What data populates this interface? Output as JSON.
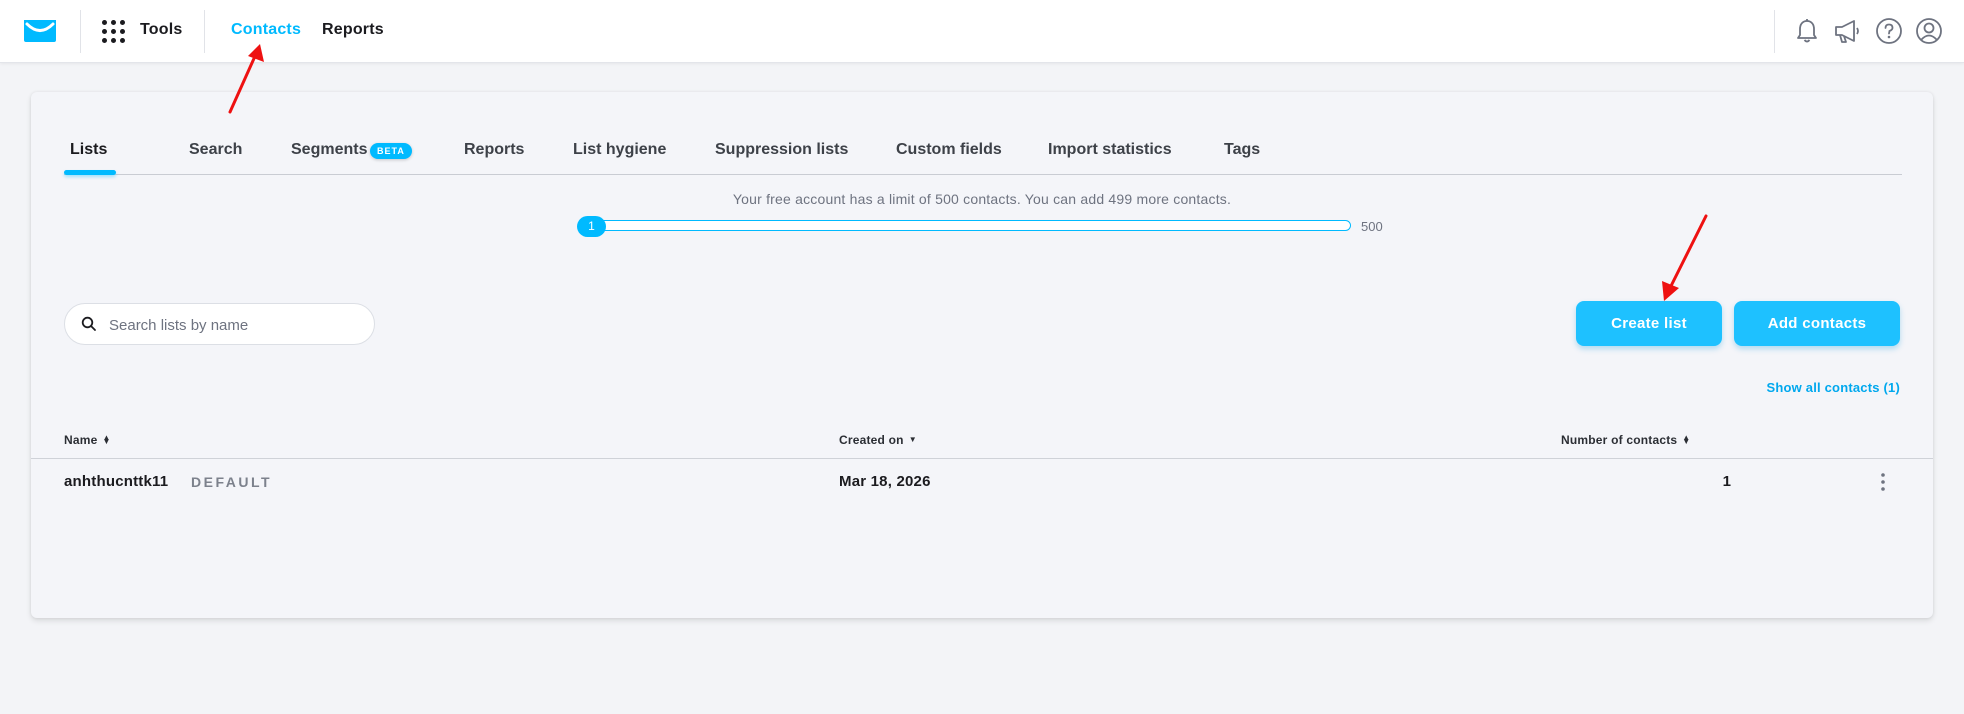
{
  "topbar": {
    "tools_label": "Tools",
    "nav": [
      {
        "label": "Contacts",
        "active": true
      },
      {
        "label": "Reports",
        "active": false
      }
    ],
    "icons": [
      "bell-icon",
      "megaphone-icon",
      "help-icon",
      "user-icon"
    ]
  },
  "tabs": [
    {
      "label": "Lists",
      "active": true
    },
    {
      "label": "Search",
      "active": false
    },
    {
      "label": "Segments",
      "active": false,
      "badge": "BETA"
    },
    {
      "label": "Reports",
      "active": false
    },
    {
      "label": "List hygiene",
      "active": false
    },
    {
      "label": "Suppression lists",
      "active": false
    },
    {
      "label": "Custom fields",
      "active": false
    },
    {
      "label": "Import statistics",
      "active": false
    },
    {
      "label": "Tags",
      "active": false
    }
  ],
  "limit": {
    "text": "Your free account has a limit of 500 contacts. You can add 499 more contacts.",
    "current": "1",
    "max": "500",
    "fill_fraction": 0.002
  },
  "search": {
    "placeholder": "Search lists by name",
    "value": ""
  },
  "buttons": {
    "create_list": "Create list",
    "add_contacts": "Add contacts"
  },
  "show_all": "Show all contacts (1)",
  "table": {
    "columns": [
      {
        "label": "Name",
        "sort": "both"
      },
      {
        "label": "Created on",
        "sort": "down"
      },
      {
        "label": "Number of contacts",
        "sort": "both"
      }
    ],
    "rows": [
      {
        "name": "anhthucnttk11",
        "badge": "DEFAULT",
        "created_on": "Mar 18, 2026",
        "count": "1"
      }
    ]
  },
  "colors": {
    "accent": "#00baff",
    "button": "#1ec1ff",
    "link": "#00a8ee",
    "annotation": "#ee1111"
  }
}
